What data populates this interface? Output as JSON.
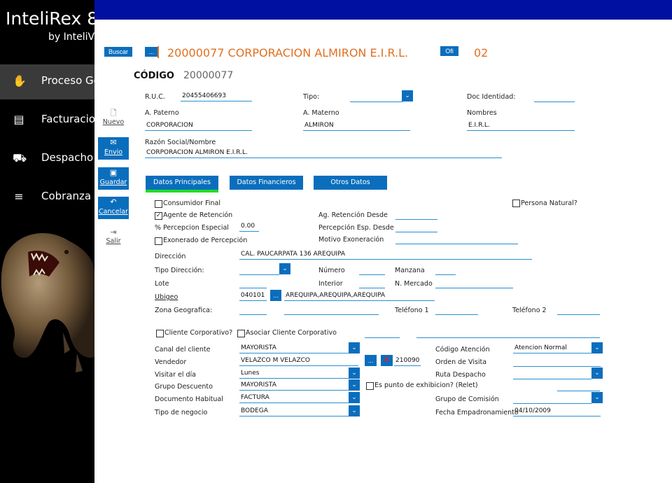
{
  "sidebar": {
    "brand": "InteliRex 8",
    "brand_sub": "by InteliV",
    "items": [
      {
        "label": "Proceso Ge",
        "icon": "hand-icon"
      },
      {
        "label": "Facturacion",
        "icon": "receipt-icon"
      },
      {
        "label": "Despacho",
        "icon": "truck-icon"
      },
      {
        "label": "Cobranza",
        "icon": "cash-icon"
      }
    ]
  },
  "header": {
    "buscar": "Buscar",
    "dots": "...",
    "title": "20000077 CORPORACION ALMIRON E.I.R.L.",
    "ofi": "Ofi",
    "ofi_value": "02",
    "codigo_label": "CÓDIGO",
    "codigo_value": "20000077"
  },
  "toolbar": {
    "nuevo": "Nuevo",
    "envio": "Envio",
    "guardar": "Guardar",
    "cancelar": "Cancelar",
    "salir": "Salir"
  },
  "ident": {
    "ruc_label": "R.U.C.",
    "ruc": "20455406693",
    "tipo_label": "Tipo:",
    "doc_label": "Doc Identidad:",
    "apaterno_label": "A. Paterno",
    "apaterno": "CORPORACION",
    "amaterno_label": "A. Materno",
    "amaterno": "ALMIRON",
    "nombres_label": "Nombres",
    "nombres": "E.I.R.L.",
    "razon_label": "Razón Social/Nombre",
    "razon": "CORPORACION ALMIRON E.I.R.L."
  },
  "tabs": [
    "Datos Principales",
    "Datos Financieros",
    "Otros Datos"
  ],
  "form": {
    "consumidor_final": "Consumidor Final",
    "persona_natural": "Persona Natural?",
    "agente_retencion": "Agente de Retención",
    "ag_ret_desde": "Ag. Retención Desde",
    "percepcion_especial": "% Percepcion Especial",
    "percepcion_value": "0.00",
    "perc_esp_desde": "Percepción Esp. Desde",
    "exonerado": "Exonerado de Percepción",
    "motivo": "Motivo Exoneración",
    "direccion_label": "Dirección",
    "direccion": "CAL. PAUCARPATA 136 AREQUIPA",
    "tipo_direccion": "Tipo Dirección:",
    "numero": "Número",
    "manzana": "Manzana",
    "lote": "Lote",
    "interior": "Interior",
    "n_mercado": "N. Mercado",
    "ubigeo_label": "Ubigeo",
    "ubigeo_code": "040101",
    "ubigeo_text": "AREQUIPA,AREQUIPA,AREQUIPA",
    "zona": "Zona Geografica:",
    "telefono1": "Teléfono 1",
    "telefono2": "Teléfono 2",
    "cliente_corp": "Cliente Corporativo?",
    "asociar_corp": "Asociar Cliente Corporativo",
    "canal_label": "Canal del cliente",
    "canal": "MAYORISTA",
    "codigo_atencion_label": "Código Atención",
    "codigo_atencion": "Atencion Normal",
    "vendedor_label": "Vendedor",
    "vendedor": "VELAZCO M VELAZCO",
    "vendedor_code": "210090",
    "orden_visita": "Orden de Visita",
    "visitar_label": "Visitar el día",
    "visitar": "Lunes",
    "ruta_despacho": "Ruta Despacho",
    "grupo_desc_label": "Grupo Descuento",
    "grupo_desc": "MAYORISTA",
    "punto_exhib": "Es punto de exhibicion?  (Relet)",
    "doc_habitual_label": "Documento Habitual",
    "doc_habitual": "FACTURA",
    "grupo_comision": "Grupo de Comisión",
    "tipo_negocio_label": "Tipo de negocio",
    "tipo_negocio": "BODEGA",
    "fecha_emp_label": "Fecha Empadronamiento",
    "fecha_emp": "04/10/2009"
  }
}
